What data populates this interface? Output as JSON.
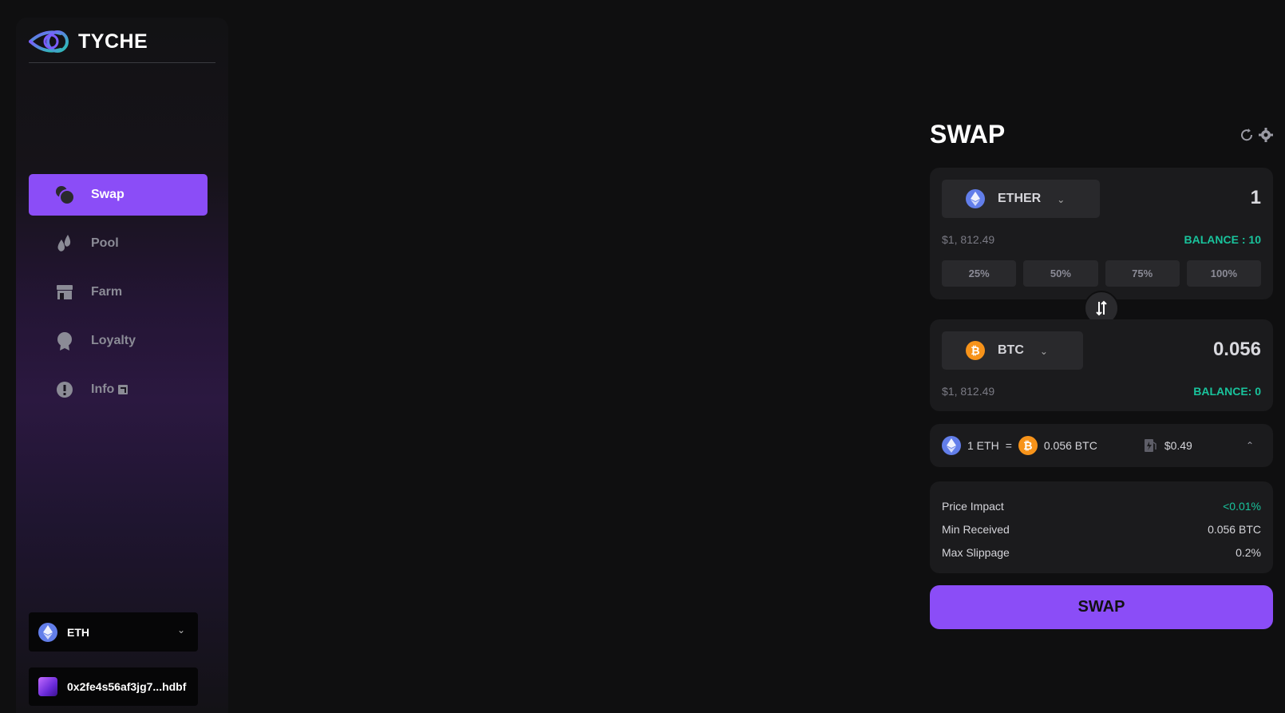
{
  "brand": {
    "name": "TYCHE"
  },
  "nav": {
    "items": [
      {
        "label": "Swap",
        "icon": "swap-icon",
        "active": true
      },
      {
        "label": "Pool",
        "icon": "drops-icon",
        "active": false
      },
      {
        "label": "Farm",
        "icon": "store-icon",
        "active": false
      },
      {
        "label": "Loyalty",
        "icon": "badge-icon",
        "active": false
      },
      {
        "label": "Info",
        "icon": "info-icon",
        "active": false
      }
    ]
  },
  "network": {
    "label": "ETH",
    "icon": "eth-icon"
  },
  "wallet": {
    "address": "0x2fe4s56af3jg7...hdbf"
  },
  "swap": {
    "title": "SWAP",
    "from": {
      "token": "ETHER",
      "amount": "1",
      "usd": "$1, 812.49",
      "balance": "BALANCE : 10",
      "percents": [
        "25%",
        "50%",
        "75%",
        "100%"
      ]
    },
    "to": {
      "token": "BTC",
      "amount": "0.056",
      "usd": "$1, 812.49",
      "balance": "BALANCE: 0"
    },
    "rate": {
      "left": "1 ETH",
      "equals": "=",
      "right": "0.056 BTC",
      "gas": "$0.49"
    },
    "details": {
      "price_impact_label": "Price Impact",
      "price_impact_value": "<0.01%",
      "min_received_label": "Min Received",
      "min_received_value": "0.056 BTC",
      "max_slippage_label": "Max Slippage",
      "max_slippage_value": "0.2%"
    },
    "button_label": "SWAP"
  },
  "colors": {
    "accent": "#8b4df7",
    "positive": "#19c39c",
    "eth": "#627eea",
    "btc": "#f7931a"
  }
}
